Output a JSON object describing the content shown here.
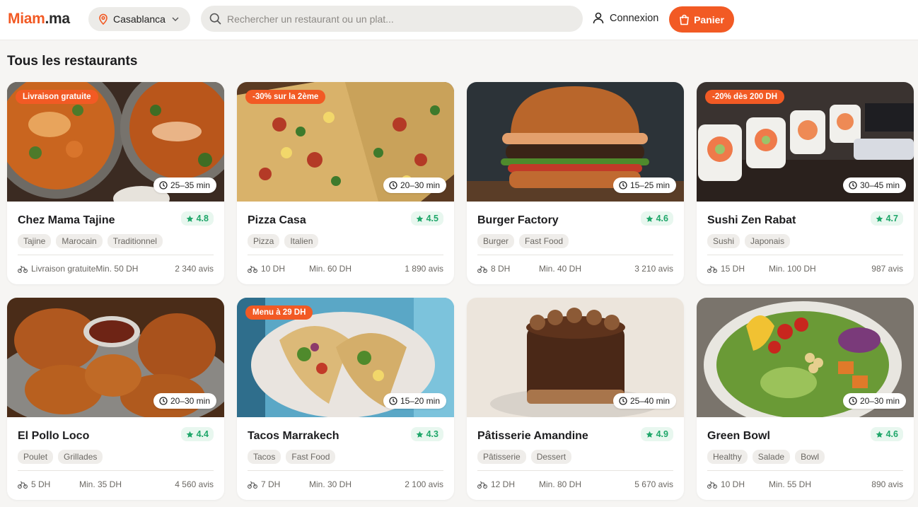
{
  "brand": {
    "part1": "Miam",
    "part2": ".ma"
  },
  "header": {
    "city": "Casablanca",
    "search_placeholder": "Rechercher un restaurant ou un plat...",
    "login_label": "Connexion",
    "cart_label": "Panier"
  },
  "section_title": "Tous les restaurants",
  "colors": {
    "accent": "#f25a24",
    "rating": "#1ea669",
    "background": "#f6f5f3"
  },
  "restaurants": [
    {
      "name": "Chez Mama Tajine",
      "rating": "4.8",
      "time": "25–35 min",
      "promo": "Livraison gratuite",
      "tags": [
        "Tajine",
        "Marocain",
        "Traditionnel"
      ],
      "delivery": "Livraison gratuite",
      "min": "Min. 50 DH",
      "reviews": "2 340 avis",
      "image": "curry-bowls"
    },
    {
      "name": "Pizza Casa",
      "rating": "4.5",
      "time": "20–30 min",
      "promo": "-30% sur la 2ème",
      "tags": [
        "Pizza",
        "Italien"
      ],
      "delivery": "10 DH",
      "min": "Min. 60 DH",
      "reviews": "1 890 avis",
      "image": "pizza"
    },
    {
      "name": "Burger Factory",
      "rating": "4.6",
      "time": "15–25 min",
      "promo": "",
      "tags": [
        "Burger",
        "Fast Food"
      ],
      "delivery": "8 DH",
      "min": "Min. 40 DH",
      "reviews": "3 210 avis",
      "image": "burger"
    },
    {
      "name": "Sushi Zen Rabat",
      "rating": "4.7",
      "time": "30–45 min",
      "promo": "-20% dès 200 DH",
      "tags": [
        "Sushi",
        "Japonais"
      ],
      "delivery": "15 DH",
      "min": "Min. 100 DH",
      "reviews": "987 avis",
      "image": "sushi"
    },
    {
      "name": "El Pollo Loco",
      "rating": "4.4",
      "time": "20–30 min",
      "promo": "",
      "tags": [
        "Poulet",
        "Grillades"
      ],
      "delivery": "5 DH",
      "min": "Min. 35 DH",
      "reviews": "4 560 avis",
      "image": "fried-chicken"
    },
    {
      "name": "Tacos Marrakech",
      "rating": "4.3",
      "time": "15–20 min",
      "promo": "Menu à 29 DH",
      "tags": [
        "Tacos",
        "Fast Food"
      ],
      "delivery": "7 DH",
      "min": "Min. 30 DH",
      "reviews": "2 100 avis",
      "image": "tacos"
    },
    {
      "name": "Pâtisserie Amandine",
      "rating": "4.9",
      "time": "25–40 min",
      "promo": "",
      "tags": [
        "Pâtisserie",
        "Dessert"
      ],
      "delivery": "12 DH",
      "min": "Min. 80 DH",
      "reviews": "5 670 avis",
      "image": "chocolate-cake"
    },
    {
      "name": "Green Bowl",
      "rating": "4.6",
      "time": "20–30 min",
      "promo": "",
      "tags": [
        "Healthy",
        "Salade",
        "Bowl"
      ],
      "delivery": "10 DH",
      "min": "Min. 55 DH",
      "reviews": "890 avis",
      "image": "salad-bowl"
    }
  ]
}
